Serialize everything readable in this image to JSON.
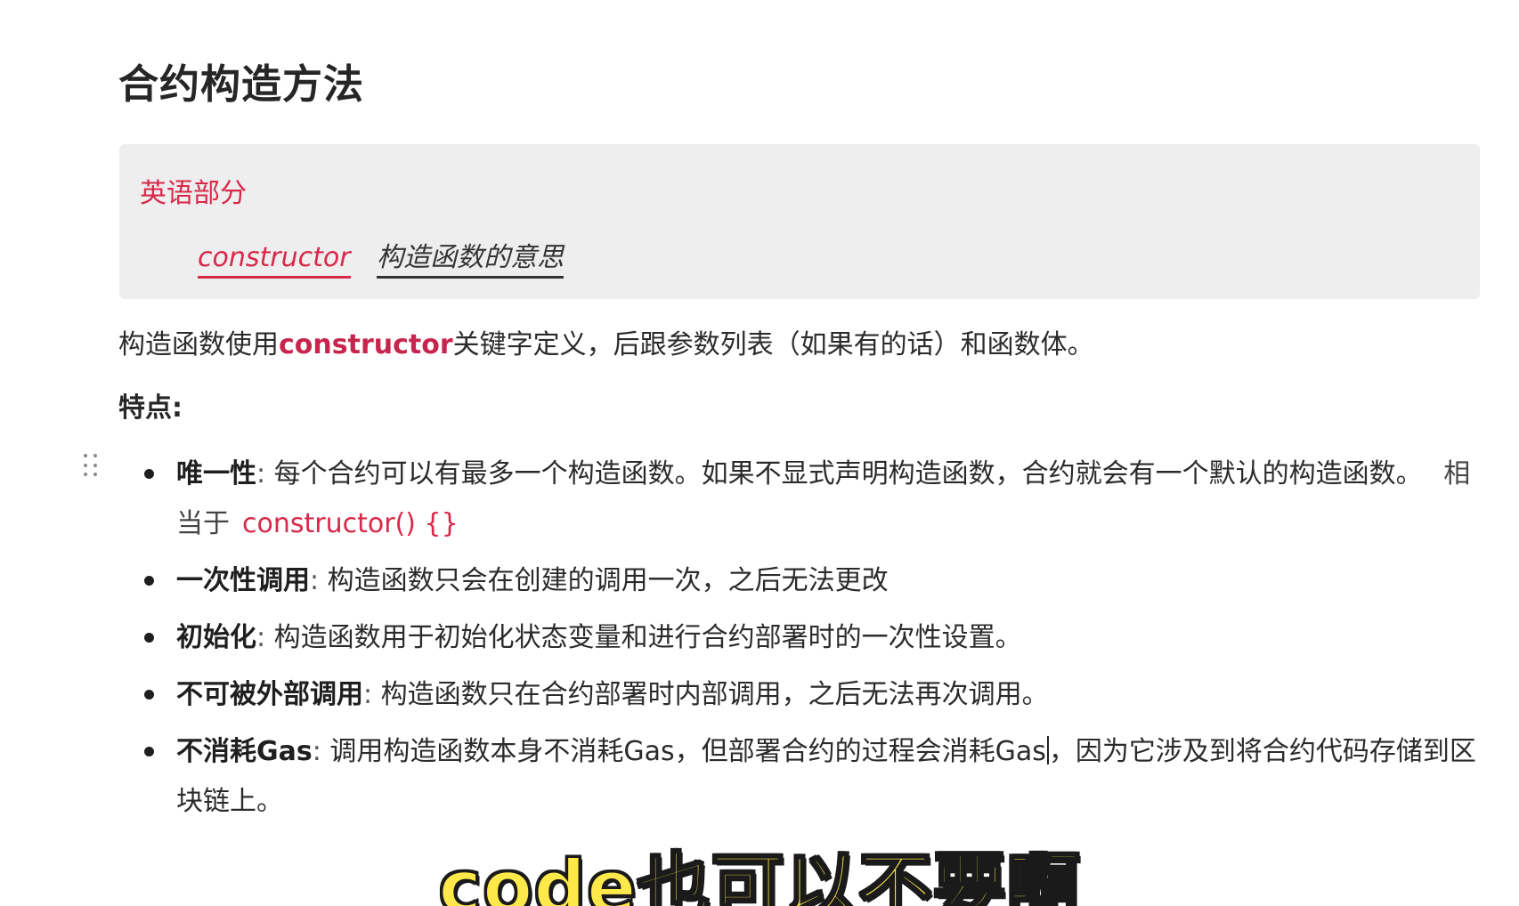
{
  "heading": "合约构造方法",
  "callout": {
    "title": "英语部分",
    "term_en": "constructor",
    "term_cn": "构造函数的意思"
  },
  "intro": {
    "before": "构造函数使用",
    "keyword": "constructor",
    "after": "关键字定义，后跟参数列表（如果有的话）和函数体。"
  },
  "features_label": "特点:",
  "features": [
    {
      "name": "唯一性",
      "sep": ": ",
      "text": "每个合约可以有最多一个构造函数。如果不显式声明构造函数，合约就会有一个默认的构造函数。",
      "extra_prefix": "相当于",
      "extra_code": "constructor() {}"
    },
    {
      "name": "一次性调用",
      "sep": ": ",
      "text": "构造函数只会在创建的调用一次，之后无法更改"
    },
    {
      "name": "初始化",
      "sep": ": ",
      "text": "构造函数用于初始化状态变量和进行合约部署时的一次性设置。"
    },
    {
      "name": "不可被外部调用",
      "sep": ": ",
      "text": "构造函数只在合约部署时内部调用，之后无法再次调用。"
    },
    {
      "name": "不消耗Gas",
      "sep": ": ",
      "text_before_caret": "调用构造函数本身不消耗Gas，但部署合约的过程会消耗Gas",
      "text_after_caret": "，因为它涉及到将合约代码存储到区块链上。"
    }
  ],
  "subtitle": "code也可以不要啊"
}
